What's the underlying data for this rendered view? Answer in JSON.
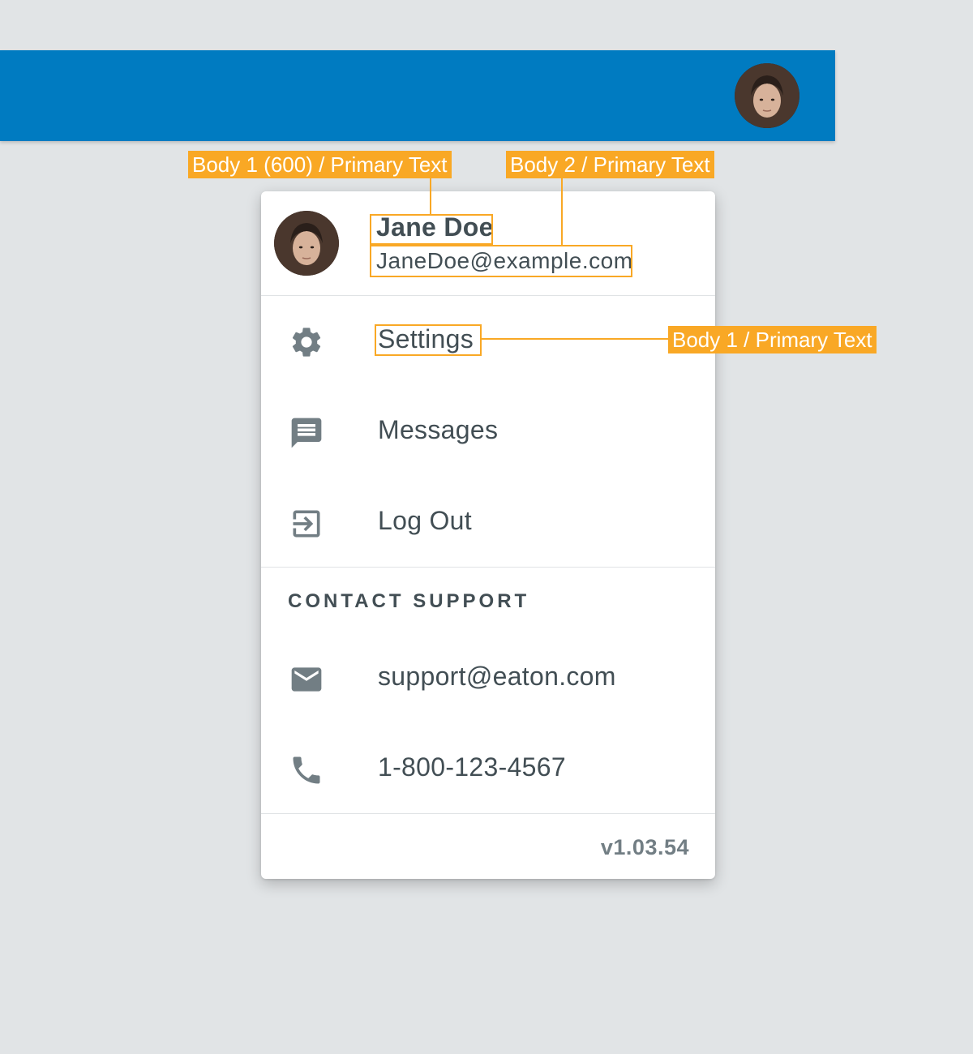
{
  "user": {
    "name": "Jane Doe",
    "email": "JaneDoe@example.com"
  },
  "menu": {
    "items": [
      {
        "label": "Settings",
        "icon": "gear-icon"
      },
      {
        "label": "Messages",
        "icon": "message-icon"
      },
      {
        "label": "Log Out",
        "icon": "logout-icon"
      }
    ],
    "support": {
      "title": "CONTACT SUPPORT",
      "items": [
        {
          "label": "support@eaton.com",
          "icon": "mail-icon"
        },
        {
          "label": "1-800-123-4567",
          "icon": "phone-icon"
        }
      ]
    },
    "version": "v1.03.54"
  },
  "annotations": {
    "name_label": "Body 1 (600) / Primary Text",
    "email_label": "Body 2 / Primary Text",
    "item_label": "Body 1 / Primary Text"
  },
  "colors": {
    "appbar": "#007bc1",
    "background": "#e1e4e6",
    "primary_text": "#424e54",
    "icon": "#727e84",
    "annotation": "#f9a825"
  }
}
